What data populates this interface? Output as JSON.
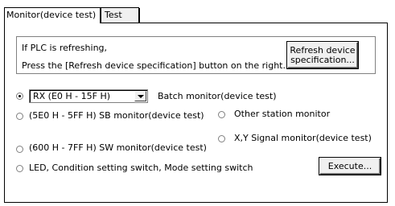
{
  "tabs": [
    {
      "label": "Monitor(device test)",
      "active": true
    },
    {
      "label": "Test",
      "active": false
    }
  ],
  "info": {
    "line1": "If PLC is refreshing,",
    "line2": "Press the [Refresh device specification] button on the right."
  },
  "refresh_button": {
    "line1": "Refresh device",
    "line2": "specification..."
  },
  "combo": {
    "value": "RX (E0 H - 15F H)",
    "icon": "chevron-down-icon"
  },
  "options": {
    "batch_monitor": {
      "label": "Batch monitor(device test)",
      "checked": true
    },
    "sb_monitor": {
      "label": "(5E0 H - 5FF H) SB monitor(device test)",
      "checked": false
    },
    "other_station": {
      "label": "Other station monitor",
      "checked": false
    },
    "sw_monitor": {
      "label": "(600 H - 7FF H) SW monitor(device test)",
      "checked": false
    },
    "xy_signal": {
      "label": "X,Y Signal monitor(device test)",
      "checked": false
    },
    "led_condition": {
      "label": "LED, Condition setting switch, Mode setting switch",
      "checked": false
    }
  },
  "execute_button": {
    "label": "Execute..."
  }
}
